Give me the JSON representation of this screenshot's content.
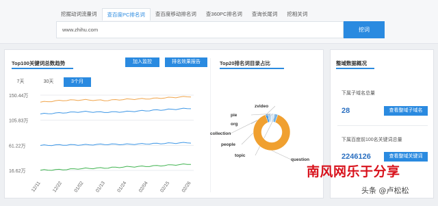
{
  "search": {
    "tabs": [
      "挖掘动词流量词",
      "查百度PC排名词",
      "查百度移动排名词",
      "查360PC排名词",
      "查询长尾词",
      "挖相关词"
    ],
    "active_tab": 1,
    "query": "www.zhihu.com",
    "button": "挖词"
  },
  "trend_panel": {
    "title": "Top100关键词总数趋势",
    "add_button": "加入监控",
    "report_button": "排名效果报告",
    "ranges": [
      "7天",
      "30天",
      "3个月"
    ],
    "active_range": 2
  },
  "pie_panel": {
    "title": "Top20排名词目录占比"
  },
  "overview_panel": {
    "title": "整域数据概况",
    "subdomains_label": "下属子域名总量",
    "subdomains_value": "28",
    "subdomains_button": "查看整域子域名",
    "keywords_label": "下属百度前100名关键词总量",
    "keywords_value": "2246126",
    "keywords_button": "查看整域关键词"
  },
  "chart_data": [
    {
      "type": "line",
      "title": "Top100关键词总数趋势",
      "x": [
        "12/11",
        "12/22",
        "01/02",
        "01/13",
        "01/24",
        "02/04",
        "02/15",
        "02/26"
      ],
      "y_ticks": [
        "150.44万",
        "105.83万",
        "61.22万",
        "16.62万"
      ],
      "ylim": [
        16.62,
        150.44
      ],
      "grid": true,
      "series": [
        {
          "color": "#f0a44a",
          "values": [
            138,
            141,
            142,
            141,
            143,
            144,
            146,
            148
          ]
        },
        {
          "color": "#3c96e6",
          "values": [
            117,
            119,
            121,
            120,
            121,
            123,
            125,
            127
          ]
        },
        {
          "color": "#3c96e6",
          "values": [
            61,
            62,
            62,
            63,
            63,
            64,
            65,
            66
          ]
        },
        {
          "color": "#3fb34f",
          "values": [
            17,
            18,
            20,
            21,
            23,
            24,
            26,
            28
          ]
        }
      ]
    },
    {
      "type": "pie",
      "title": "Top20排名词目录占比",
      "categories": [
        "zvideo",
        "pie",
        "org",
        "collection",
        "people",
        "topic",
        "question"
      ],
      "values": [
        2,
        1,
        1,
        1,
        3,
        3,
        89
      ],
      "colors": [
        "#2a8ae0",
        "#8cc1ee",
        "#5aa6e8",
        "#b9d7f2",
        "#d9e8f6",
        "#6fb3ea",
        "#f0a030"
      ]
    }
  ],
  "watermark": {
    "logo": "南风网乐于分享",
    "credit": "头条 @卢松松"
  }
}
